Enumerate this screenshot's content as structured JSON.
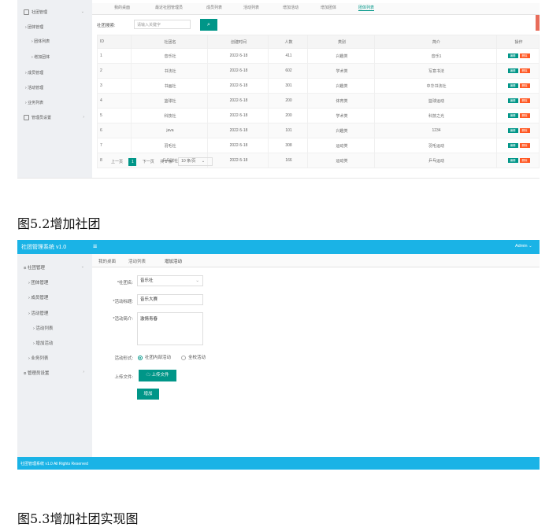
{
  "figure1": {
    "sidebar": {
      "items": [
        {
          "label": "社团管理",
          "icon": "user-icon"
        },
        {
          "label": "团体管理"
        },
        {
          "label": "团体列表"
        },
        {
          "label": "增加团体"
        },
        {
          "label": "成员管理"
        },
        {
          "label": "活动管理"
        },
        {
          "label": "业务列表"
        },
        {
          "label": "管理员设置",
          "icon": "user-icon"
        }
      ]
    },
    "tabs": [
      "我的桌面",
      "最近社团管理员",
      "成员列表",
      "活动列表",
      "增加活动",
      "增加团体",
      "团体列表"
    ],
    "search": {
      "label": "社团搜索:",
      "placeholder": "请输入关键字"
    },
    "table": {
      "headers": [
        "ID",
        "社团名",
        "创建时间",
        "人数",
        "类别",
        "简介",
        "操作"
      ],
      "rows": [
        [
          "1",
          "音乐社",
          "2022-5-18",
          "411",
          "兴趣类",
          "音乐1"
        ],
        [
          "2",
          "书法社",
          "2022-5-18",
          "602",
          "学术类",
          "写意书法"
        ],
        [
          "3",
          "书画社",
          "2022-5-18",
          "301",
          "兴趣类",
          "中华书法社"
        ],
        [
          "4",
          "篮球社",
          "2022-5-18",
          "200",
          "体育类",
          "篮球运动"
        ],
        [
          "5",
          "科技社",
          "2022-5-18",
          "200",
          "学术类",
          "科技之光"
        ],
        [
          "6",
          "java",
          "2022-5-18",
          "101",
          "兴趣类",
          "1234"
        ],
        [
          "7",
          "羽毛社",
          "2022-5-18",
          "308",
          "运动类",
          "羽毛运动"
        ],
        [
          "8",
          "乒乓球社",
          "2022-5-18",
          "166",
          "运动类",
          "乒乓运动"
        ]
      ],
      "edit_label": "编辑",
      "delete_label": "删除"
    },
    "pager": {
      "prev": "上一页",
      "current": "1",
      "next": "下一页",
      "total": "共 8 条",
      "page_size": "10 条/页"
    }
  },
  "caption1": "图5.2增加社团",
  "figure2": {
    "app_title": "社团管理系统 v1.0",
    "admin": "Admin",
    "sidebar": {
      "items": [
        {
          "label": "社团管理",
          "icon": "user-icon"
        },
        {
          "label": "团体管理"
        },
        {
          "label": "成员管理"
        },
        {
          "label": "活动管理"
        },
        {
          "label": "活动列表"
        },
        {
          "label": "增加活动"
        },
        {
          "label": "业务列表"
        },
        {
          "label": "管理员设置",
          "icon": "user-icon"
        }
      ]
    },
    "tabs": [
      "我的桌面",
      "活动列表",
      "增加活动"
    ],
    "form": {
      "club_label": "*社团名:",
      "club_value": "音乐社",
      "name_label": "*活动标题:",
      "name_value": "音乐大赛",
      "intro_label": "*活动简介:",
      "intro_value": "激情青春",
      "type_label": "活动形式:",
      "type_options": [
        "社团内部活动",
        "全校活动"
      ],
      "upload_label": "上传文件:",
      "upload_button": "上传文件",
      "submit_button": "增加"
    },
    "footer": "社团管理系统 v1.0 All Rights Reserved"
  },
  "caption2": "图5.3增加社团实现图",
  "colors": {
    "accent": "#009688",
    "danger": "#ff5722",
    "header": "#1ab3e6"
  }
}
